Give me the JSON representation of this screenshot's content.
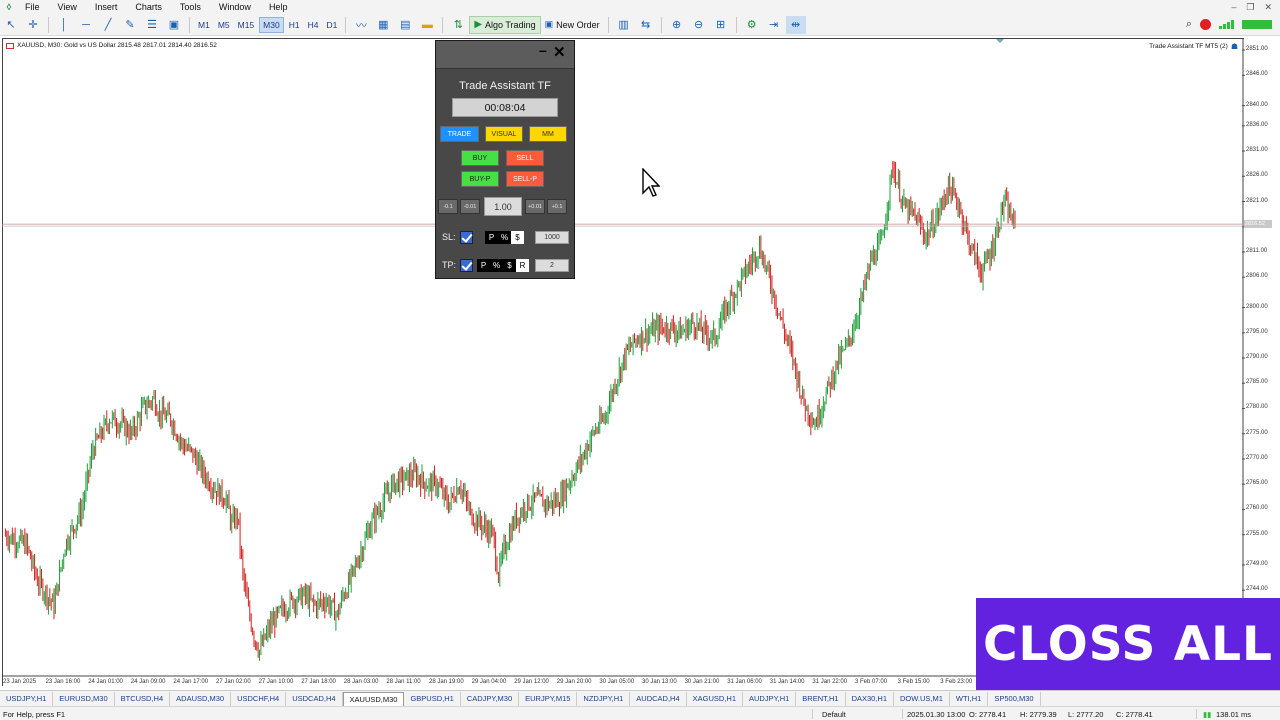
{
  "menubar": {
    "items": [
      "File",
      "View",
      "Insert",
      "Charts",
      "Tools",
      "Window",
      "Help"
    ]
  },
  "toolbar": {
    "timeframes": [
      {
        "label": "M1",
        "active": false
      },
      {
        "label": "M5",
        "active": false
      },
      {
        "label": "M15",
        "active": false
      },
      {
        "label": "M30",
        "active": true
      },
      {
        "label": "H1",
        "active": false
      },
      {
        "label": "H4",
        "active": false
      },
      {
        "label": "D1",
        "active": false
      }
    ],
    "algo_trading_label": "Algo Trading",
    "new_order_label": "New Order"
  },
  "chart": {
    "header_text": "XAUUSD, M30:  Gold vs US Dollar  2815.48 2817.01 2814.40 2816.52",
    "ea_label": "Trade Assistant TF MT5 (2)",
    "current_price_label": "2816.52",
    "colors": {
      "bull": "#1e9e3a",
      "bear": "#d42020",
      "price_line": "#c98a8a"
    }
  },
  "chart_data": {
    "type": "candlestick",
    "symbol": "XAUUSD",
    "timeframe": "M30",
    "y_ticks": [
      2851.0,
      2846.0,
      2840.0,
      2836.0,
      2831.0,
      2826.0,
      2821.0,
      2816.0,
      2811.0,
      2806.0,
      2800.0,
      2795.0,
      2790.0,
      2785.0,
      2780.0,
      2775.0,
      2770.0,
      2765.0,
      2760.0,
      2755.0,
      2749.0,
      2744.0,
      2739.0,
      2734.0,
      2729.0
    ],
    "ylim": [
      2727.0,
      2853.0
    ],
    "x_ticks": [
      "23 Jan 2025",
      "23 Jan 16:00",
      "24 Jan 01:00",
      "24 Jan 09:00",
      "24 Jan 17:00",
      "27 Jan 02:00",
      "27 Jan 10:00",
      "27 Jan 18:00",
      "28 Jan 03:00",
      "28 Jan 11:00",
      "28 Jan 19:00",
      "29 Jan 04:00",
      "29 Jan 12:00",
      "29 Jan 20:00",
      "30 Jan 05:00",
      "30 Jan 13:00",
      "30 Jan 21:00",
      "31 Jan 06:00",
      "31 Jan 14:00",
      "31 Jan 22:00",
      "3 Feb 07:00",
      "3 Feb 15:00",
      "3 Feb 23:00"
    ],
    "current_price": 2816.52,
    "close_path": [
      [
        0,
        2755
      ],
      [
        4,
        2753
      ],
      [
        6,
        2746
      ],
      [
        9,
        2741
      ],
      [
        11,
        2753
      ],
      [
        14,
        2760
      ],
      [
        16,
        2772
      ],
      [
        19,
        2778
      ],
      [
        21,
        2777
      ],
      [
        23,
        2775
      ],
      [
        25,
        2780
      ],
      [
        27,
        2782
      ],
      [
        28,
        2779
      ],
      [
        30,
        2778
      ],
      [
        32,
        2773
      ],
      [
        34,
        2771
      ],
      [
        36,
        2767
      ],
      [
        38,
        2764
      ],
      [
        40,
        2762
      ],
      [
        41,
        2757
      ],
      [
        42,
        2759
      ],
      [
        43,
        2747
      ],
      [
        44,
        2740
      ],
      [
        45,
        2735
      ],
      [
        46,
        2732
      ],
      [
        48,
        2737
      ],
      [
        50,
        2740
      ],
      [
        52,
        2742
      ],
      [
        54,
        2743
      ],
      [
        56,
        2741
      ],
      [
        58,
        2742
      ],
      [
        60,
        2739
      ],
      [
        61,
        2743
      ],
      [
        62,
        2745
      ],
      [
        64,
        2751
      ],
      [
        66,
        2757
      ],
      [
        68,
        2761
      ],
      [
        70,
        2765
      ],
      [
        72,
        2766
      ],
      [
        74,
        2767
      ],
      [
        76,
        2765
      ],
      [
        78,
        2765
      ],
      [
        80,
        2761
      ],
      [
        82,
        2765
      ],
      [
        84,
        2759
      ],
      [
        86,
        2757
      ],
      [
        88,
        2755
      ],
      [
        89,
        2747
      ],
      [
        90,
        2752
      ],
      [
        92,
        2758
      ],
      [
        94,
        2761
      ],
      [
        96,
        2762
      ],
      [
        98,
        2761
      ],
      [
        100,
        2762
      ],
      [
        102,
        2766
      ],
      [
        104,
        2770
      ],
      [
        106,
        2775
      ],
      [
        108,
        2778
      ],
      [
        110,
        2785
      ],
      [
        112,
        2791
      ],
      [
        114,
        2794
      ],
      [
        116,
        2795
      ],
      [
        118,
        2796
      ],
      [
        120,
        2796
      ],
      [
        122,
        2795
      ],
      [
        124,
        2797
      ],
      [
        126,
        2795
      ],
      [
        128,
        2794
      ],
      [
        130,
        2800
      ],
      [
        132,
        2804
      ],
      [
        134,
        2808
      ],
      [
        136,
        2812
      ],
      [
        138,
        2805
      ],
      [
        140,
        2797
      ],
      [
        142,
        2790
      ],
      [
        144,
        2781
      ],
      [
        146,
        2777
      ],
      [
        148,
        2783
      ],
      [
        150,
        2789
      ],
      [
        152,
        2793
      ],
      [
        154,
        2800
      ],
      [
        156,
        2809
      ],
      [
        158,
        2813
      ],
      [
        160,
        2828
      ],
      [
        162,
        2820
      ],
      [
        164,
        2818
      ],
      [
        166,
        2814
      ],
      [
        168,
        2818
      ],
      [
        170,
        2824
      ],
      [
        172,
        2820
      ],
      [
        174,
        2812
      ],
      [
        176,
        2807
      ],
      [
        178,
        2812
      ],
      [
        180,
        2821
      ],
      [
        182,
        2816
      ]
    ]
  },
  "ta_panel": {
    "title": "Trade Assistant TF",
    "timer": "00:08:04",
    "minimize_glyph": "–",
    "close_glyph": "✕",
    "tabs": [
      "TRADE",
      "VISUAL",
      "MM"
    ],
    "buy_label": "BUY",
    "sell_label": "SELL",
    "buy_pending_label": "BUY-P",
    "sell_pending_label": "SELL-P",
    "steps": [
      "-0.1",
      "-0.01",
      "+0.01",
      "+0.1"
    ],
    "lot": "1.00",
    "sl_label": "SL:",
    "tp_label": "TP:",
    "sl_modes": [
      "P",
      "%",
      "$"
    ],
    "tp_modes": [
      "P",
      "%",
      "$",
      "R"
    ],
    "sl_value": "1000",
    "tp_value": "2"
  },
  "overlay": {
    "text": "CLOSS ALL",
    "color": "#6222e0"
  },
  "symbol_tabs": [
    {
      "label": "USDJPY,H1",
      "active": false
    },
    {
      "label": "EURUSD,M30",
      "active": false
    },
    {
      "label": "BTCUSD,H4",
      "active": false
    },
    {
      "label": "ADAUSD,M30",
      "active": false
    },
    {
      "label": "USDCHF,H4",
      "active": false
    },
    {
      "label": "USDCAD,H4",
      "active": false
    },
    {
      "label": "XAUUSD,M30",
      "active": true
    },
    {
      "label": "GBPUSD,H1",
      "active": false
    },
    {
      "label": "CADJPY,M30",
      "active": false
    },
    {
      "label": "EURJPY,M15",
      "active": false
    },
    {
      "label": "NZDJPY,H1",
      "active": false
    },
    {
      "label": "AUDCAD,H4",
      "active": false
    },
    {
      "label": "XAGUSD,H1",
      "active": false
    },
    {
      "label": "AUDJPY,H1",
      "active": false
    },
    {
      "label": "BRENT,H1",
      "active": false
    },
    {
      "label": "DAX30,H1",
      "active": false
    },
    {
      "label": "DOW.US,M1",
      "active": false
    },
    {
      "label": "WTI,H1",
      "active": false
    },
    {
      "label": "SP500,M30",
      "active": false
    }
  ],
  "statusbar": {
    "help": "For Help, press F1",
    "profile": "Default",
    "datetime": "2025.01.30 13:00",
    "open": "O: 2778.41",
    "high": "H: 2779.39",
    "low": "L: 2777.20",
    "close": "C: 2778.41",
    "traffic": "138.01 ms"
  }
}
